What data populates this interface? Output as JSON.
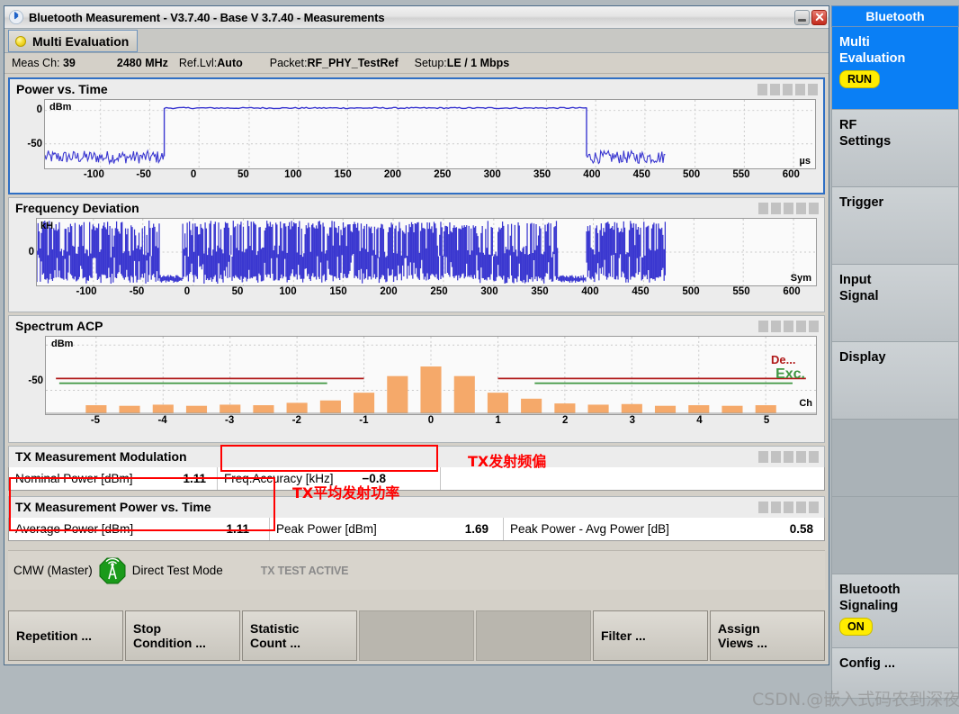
{
  "window": {
    "title": "Bluetooth Measurement  - V3.7.40 - Base V 3.7.40 - Measurements",
    "logo_icon": "bluetooth-icon",
    "minimize_icon": "minimize-icon",
    "close_icon": "close-icon"
  },
  "tab": {
    "label": "Multi Evaluation",
    "status_icon": "yellow-status-dot"
  },
  "infoline": {
    "meas_ch_label": "Meas Ch:",
    "meas_ch_value": "39",
    "freq_value": "2480",
    "freq_unit": "MHz",
    "reflvl_label": "Ref.Lvl:",
    "reflvl_value": "Auto",
    "packet_label": "Packet:",
    "packet_value": "RF_PHY_TestRef",
    "setup_label": "Setup:",
    "setup_value": "LE / 1 Mbps"
  },
  "panels": {
    "power_vs_time": {
      "title": "Power vs. Time"
    },
    "freq_deviation": {
      "title": "Frequency Deviation"
    },
    "spectrum_acp": {
      "title": "Spectrum ACP"
    },
    "tx_modulation": {
      "title": "TX Measurement Modulation"
    },
    "tx_pvt": {
      "title": "TX Measurement Power vs. Time"
    }
  },
  "results": {
    "nominal_power_label": "Nominal Power [dBm]",
    "nominal_power_value": "1.11",
    "freq_accuracy_label": "Freq.Accuracy [kHz]",
    "freq_accuracy_value": "−0.8",
    "average_power_label": "Average Power [dBm]",
    "average_power_value": "1.11",
    "peak_power_label": "Peak Power [dBm]",
    "peak_power_value": "1.69",
    "peak_minus_avg_label": "Peak Power - Avg Power [dB]",
    "peak_minus_avg_value": "0.58"
  },
  "annotations": {
    "freq_accuracy_note": "TX发射频偏",
    "avg_power_note": "TX平均发射功率",
    "box_color": "#ff0000"
  },
  "statusbar": {
    "device": "CMW (Master)",
    "antenna_icon": "antenna-transmitter-icon",
    "mode": "Direct Test Mode",
    "state": "TX TEST ACTIVE"
  },
  "softkeys": [
    {
      "label": "Repetition ...",
      "empty": false
    },
    {
      "label": "Stop\nCondition ...",
      "empty": false
    },
    {
      "label": "Statistic\nCount ...",
      "empty": false
    },
    {
      "label": "",
      "empty": true
    },
    {
      "label": "",
      "empty": true
    },
    {
      "label": "Filter ...",
      "empty": false
    },
    {
      "label": "Assign\nViews ...",
      "empty": false
    }
  ],
  "rightmenu": {
    "title": "Bluetooth",
    "items": [
      {
        "label": "Multi\nEvaluation",
        "badge": "RUN",
        "state": "active"
      },
      {
        "label": "RF\nSettings",
        "badge": "",
        "state": "normal"
      },
      {
        "label": "Trigger",
        "badge": "",
        "state": "normal"
      },
      {
        "label": "Input\nSignal",
        "badge": "",
        "state": "normal"
      },
      {
        "label": "Display",
        "badge": "",
        "state": "normal"
      },
      {
        "label": "",
        "badge": "",
        "state": "blank"
      },
      {
        "label": "",
        "badge": "",
        "state": "blank"
      },
      {
        "label": "Bluetooth\nSignaling",
        "badge": "ON",
        "state": "normal"
      },
      {
        "label": "Config ...",
        "badge": "",
        "state": "normal"
      }
    ]
  },
  "watermark": {
    "text": "CSDN.@嵌入式码农到深夜"
  },
  "chart_data": [
    {
      "id": "power_vs_time",
      "type": "line",
      "title": "Power vs. Time",
      "xlabel": "",
      "ylabel": "",
      "x_unit": "µs",
      "y_unit": "dBm",
      "xticks": [
        -100,
        -50,
        0,
        50,
        100,
        150,
        200,
        250,
        300,
        350,
        400,
        450,
        500,
        550,
        600
      ],
      "yticks": [
        0,
        -50
      ],
      "xlim": [
        -150,
        625
      ],
      "ylim": [
        -75,
        10
      ],
      "grid": true,
      "trace_color": "#3a37d0",
      "burst_start_us": -30,
      "burst_end_us": 395,
      "burst_level_dbm": 0,
      "noise_floor_dbm": -60,
      "trace_end_us": 475,
      "series": [
        {
          "name": "Power",
          "x": [
            -150,
            -30,
            -30,
            395,
            395,
            475
          ],
          "values": [
            -60,
            -60,
            0,
            0,
            -60,
            -60
          ]
        }
      ]
    },
    {
      "id": "frequency_deviation",
      "type": "line",
      "title": "Frequency Deviation",
      "x_unit": "Sym",
      "y_unit": "kHz",
      "xticks": [
        -100,
        -50,
        0,
        50,
        100,
        150,
        200,
        250,
        300,
        350,
        400,
        450,
        500,
        550,
        600
      ],
      "yticks": [
        0
      ],
      "xlim": [
        -150,
        625
      ],
      "ylim": [
        -320,
        320
      ],
      "grid": true,
      "trace_color": "#3a37d0",
      "trace_end_sym": 475,
      "deviation_peak_khz": 250
    },
    {
      "id": "spectrum_acp",
      "type": "bar",
      "title": "Spectrum ACP",
      "x_unit": "Ch",
      "y_unit": "dBm",
      "xticks": [
        -5,
        -4,
        -3,
        -2,
        -1,
        0,
        1,
        2,
        3,
        4,
        5
      ],
      "yticks": [
        -50
      ],
      "xlim": [
        -5.75,
        5.75
      ],
      "ylim": [
        -70,
        -5
      ],
      "grid": true,
      "bar_color": "#f5a96a",
      "categories": [
        -5,
        -4.5,
        -4,
        -3.5,
        -3,
        -2.5,
        -2,
        -1.5,
        -1,
        -0.5,
        0,
        0.5,
        1,
        1.5,
        2,
        2.5,
        3,
        3.5,
        4,
        4.5,
        5
      ],
      "values": [
        -62.5,
        -63,
        -62,
        -63,
        -62,
        -62.5,
        -60.5,
        -58.5,
        -52,
        -38,
        -30,
        -38,
        -52,
        -57,
        -61,
        -62,
        -61.5,
        -63,
        -62.5,
        -63,
        -62.5
      ],
      "limit_lines": [
        {
          "name": "Dev.",
          "color": "#b01818",
          "label": "De...",
          "x_from": -5.6,
          "x_to": -1.0,
          "y": -40
        },
        {
          "name": "Dev.",
          "color": "#b01818",
          "label": "",
          "x_from": 1.0,
          "x_to": 5.6,
          "y": -40
        },
        {
          "name": "Exc.",
          "color": "#3f9641",
          "label": "",
          "x_from": -5.55,
          "x_to": -1.55,
          "y": -44
        },
        {
          "name": "Exc.",
          "color": "#3f9641",
          "label": "Exc.",
          "x_from": 1.55,
          "x_to": 5.4,
          "y": -44
        }
      ]
    }
  ]
}
